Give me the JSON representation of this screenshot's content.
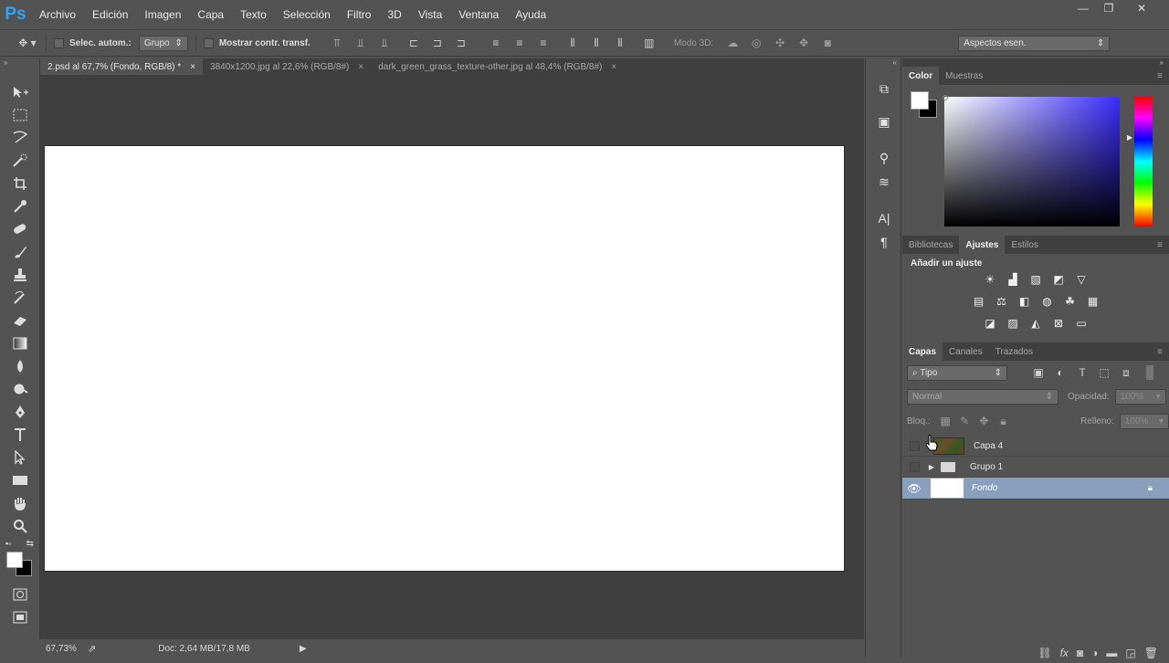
{
  "app": {
    "logo": "Ps"
  },
  "menu": [
    "Archivo",
    "Edición",
    "Imagen",
    "Capa",
    "Texto",
    "Selección",
    "Filtro",
    "3D",
    "Vista",
    "Ventana",
    "Ayuda"
  ],
  "window_controls": {
    "minimize": "—",
    "restore": "❐",
    "close": "✕"
  },
  "options": {
    "auto_select_label": "Selec. autom.:",
    "auto_select_value": "Grupo",
    "transform_label": "Mostrar contr. transf.",
    "mode3d_label": "Modo 3D:",
    "workspace_value": "Aspectos esen."
  },
  "tabs": [
    {
      "label": "2.psd al 67,7% (Fondo, RGB/8) *",
      "close": "×"
    },
    {
      "label": "3840x1200.jpg al 22,6% (RGB/8#)",
      "close": "×"
    },
    {
      "label": "dark_green_grass_texture-other.jpg al 48,4% (RGB/8#)",
      "close": "×"
    }
  ],
  "status": {
    "zoom": "67,73%",
    "doc": "Doc: 2,64 MB/17,8 MB"
  },
  "color_panel": {
    "tabs": [
      "Color",
      "Muestras"
    ]
  },
  "adjust_panel": {
    "tabs": [
      "Bibliotecas",
      "Ajustes",
      "Estilos"
    ],
    "heading": "Añadir un ajuste"
  },
  "layers_panel": {
    "tabs": [
      "Capas",
      "Canales",
      "Trazados"
    ],
    "filter_value": "Tipo",
    "blend_mode": "Normal",
    "opacity_label": "Opacidad:",
    "opacity_value": "100%",
    "lock_label": "Bloq.:",
    "fill_label": "Relleno:",
    "fill_value": "100%",
    "layers": [
      {
        "name": "Capa 4",
        "visible": false
      },
      {
        "name": "Grupo 1",
        "visible": false
      },
      {
        "name": "Fondo",
        "visible": true,
        "selected": true
      }
    ]
  },
  "colors": {
    "accent": "#2fa4ff",
    "selected_layer": "#8a9fbd"
  }
}
